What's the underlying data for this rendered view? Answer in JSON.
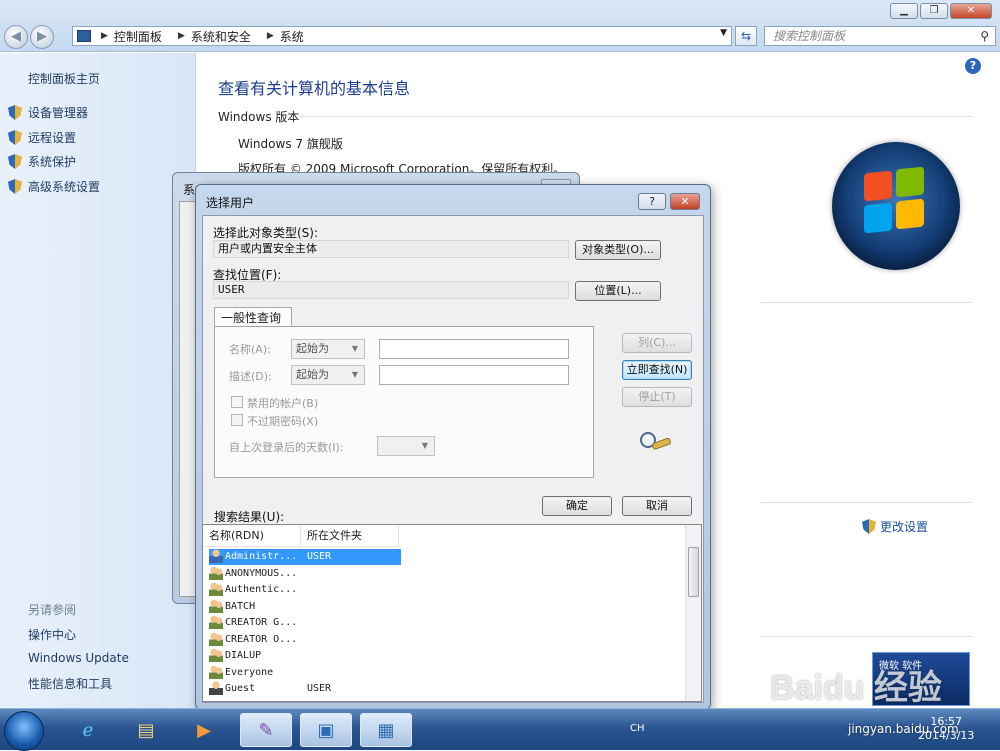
{
  "window": {
    "minimize": "▁",
    "maximize": "❐",
    "close": "✕"
  },
  "address": {
    "crumbs": [
      "控制面板",
      "系统和安全",
      "系统"
    ],
    "search_placeholder": "搜索控制面板"
  },
  "sidebar": {
    "home": "控制面板主页",
    "items": [
      {
        "label": "设备管理器",
        "icon": "shield-icon"
      },
      {
        "label": "远程设置",
        "icon": "shield-icon"
      },
      {
        "label": "系统保护",
        "icon": "shield-icon"
      },
      {
        "label": "高级系统设置",
        "icon": "shield-icon"
      }
    ],
    "see_also": "另请参阅",
    "links": [
      "操作中心",
      "Windows Update",
      "性能信息和工具"
    ]
  },
  "main": {
    "title": "查看有关计算机的基本信息",
    "section_edition": "Windows 版本",
    "edition": "Windows 7 旗舰版",
    "copyright": "版权所有 © 2009 Microsoft Corporation。保留所有权利。",
    "change_settings": "更改设置"
  },
  "behind_dialog": {
    "title": "系"
  },
  "dialog": {
    "title": "选择用户",
    "help_btn": "?",
    "close_btn": "✕",
    "object_type_label": "选择此对象类型(S):",
    "object_type_value": "用户或内置安全主体",
    "object_types_button": "对象类型(O)...",
    "location_label": "查找位置(F):",
    "location_value": "USER",
    "locations_button": "位置(L)...",
    "tab": "一般性查询",
    "name_label": "名称(A):",
    "desc_label": "描述(D):",
    "starts_with": "起始为",
    "disabled_accounts": "禁用的帐户(B)",
    "non_expiring_pw": "不过期密码(X)",
    "days_since_logon": "自上次登录后的天数(I):",
    "columns_button": "列(C)...",
    "find_now_button": "立即查找(N)",
    "stop_button": "停止(T)",
    "ok_button": "确定",
    "cancel_button": "取消",
    "results_label": "搜索结果(U):",
    "results_headers": [
      "名称(RDN)",
      "所在文件夹"
    ],
    "results": [
      {
        "name": "Administr...",
        "folder": "USER",
        "selected": true
      },
      {
        "name": "ANONYMOUS...",
        "folder": ""
      },
      {
        "name": "Authentic...",
        "folder": ""
      },
      {
        "name": "BATCH",
        "folder": ""
      },
      {
        "name": "CREATOR G...",
        "folder": ""
      },
      {
        "name": "CREATOR O...",
        "folder": ""
      },
      {
        "name": "DIALUP",
        "folder": ""
      },
      {
        "name": "Everyone",
        "folder": ""
      },
      {
        "name": "Guest",
        "folder": "USER"
      }
    ]
  },
  "taskbar": {
    "tray_lang": "CH",
    "time": "16:57",
    "date": "2014/3/13"
  },
  "overlay": {
    "badge_text": "微软 软件",
    "watermark": "Baidu 经验",
    "watermark_url": "jingyan.baidu.com"
  }
}
